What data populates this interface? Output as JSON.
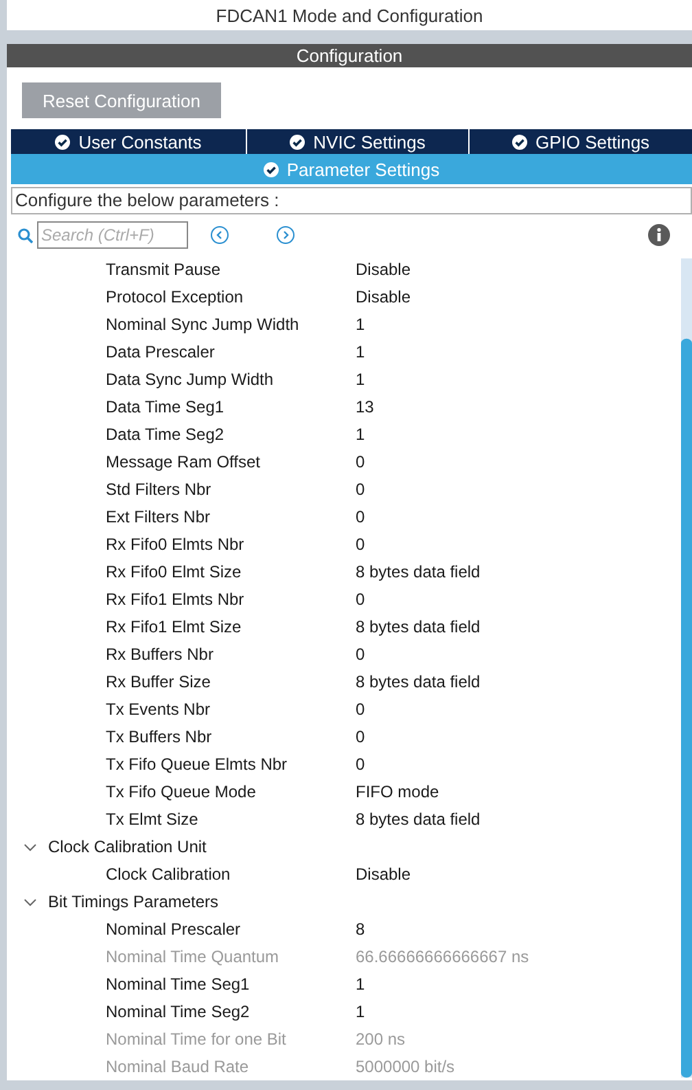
{
  "window": {
    "title": "FDCAN1 Mode and Configuration"
  },
  "section_header": "Configuration",
  "reset_button": "Reset Configuration",
  "tabs": [
    {
      "label": "User Constants",
      "selected": false,
      "kind": "upper"
    },
    {
      "label": "NVIC Settings",
      "selected": false,
      "kind": "upper"
    },
    {
      "label": "GPIO Settings",
      "selected": false,
      "kind": "upper"
    },
    {
      "label": "Parameter Settings",
      "selected": true,
      "kind": "lower"
    }
  ],
  "description": "Configure the below parameters :",
  "search": {
    "placeholder": "Search (Ctrl+F)"
  },
  "parameters": [
    {
      "name": "Transmit Pause",
      "value": "Disable",
      "disabled": false
    },
    {
      "name": "Protocol Exception",
      "value": "Disable",
      "disabled": false
    },
    {
      "name": "Nominal Sync Jump Width",
      "value": "1",
      "disabled": false
    },
    {
      "name": "Data Prescaler",
      "value": "1",
      "disabled": false
    },
    {
      "name": "Data Sync Jump Width",
      "value": "1",
      "disabled": false
    },
    {
      "name": "Data Time Seg1",
      "value": "13",
      "disabled": false
    },
    {
      "name": "Data Time Seg2",
      "value": "1",
      "disabled": false
    },
    {
      "name": "Message Ram Offset",
      "value": "0",
      "disabled": false
    },
    {
      "name": "Std Filters Nbr",
      "value": "0",
      "disabled": false
    },
    {
      "name": "Ext Filters Nbr",
      "value": "0",
      "disabled": false
    },
    {
      "name": "Rx Fifo0 Elmts Nbr",
      "value": "0",
      "disabled": false
    },
    {
      "name": "Rx Fifo0 Elmt Size",
      "value": "8 bytes data field",
      "disabled": false
    },
    {
      "name": "Rx Fifo1 Elmts Nbr",
      "value": "0",
      "disabled": false
    },
    {
      "name": "Rx Fifo1 Elmt Size",
      "value": "8 bytes data field",
      "disabled": false
    },
    {
      "name": "Rx Buffers Nbr",
      "value": "0",
      "disabled": false
    },
    {
      "name": "Rx Buffer Size",
      "value": "8 bytes data field",
      "disabled": false
    },
    {
      "name": "Tx Events Nbr",
      "value": "0",
      "disabled": false
    },
    {
      "name": "Tx Buffers Nbr",
      "value": "0",
      "disabled": false
    },
    {
      "name": "Tx Fifo Queue Elmts Nbr",
      "value": "0",
      "disabled": false
    },
    {
      "name": "Tx Fifo Queue Mode",
      "value": "FIFO mode",
      "disabled": false
    },
    {
      "name": "Tx Elmt Size",
      "value": "8 bytes data field",
      "disabled": false
    }
  ],
  "groups": [
    {
      "name": "Clock Calibration Unit",
      "expanded": true,
      "children": [
        {
          "name": "Clock Calibration",
          "value": "Disable",
          "disabled": false
        }
      ]
    },
    {
      "name": "Bit Timings Parameters",
      "expanded": true,
      "children": [
        {
          "name": "Nominal Prescaler",
          "value": "8",
          "disabled": false
        },
        {
          "name": "Nominal Time Quantum",
          "value": "66.66666666666667 ns",
          "disabled": true
        },
        {
          "name": "Nominal Time Seg1",
          "value": "1",
          "disabled": false
        },
        {
          "name": "Nominal Time Seg2",
          "value": "1",
          "disabled": false
        },
        {
          "name": "Nominal Time for one Bit",
          "value": "200 ns",
          "disabled": true
        },
        {
          "name": "Nominal Baud Rate",
          "value": "5000000 bit/s",
          "disabled": true
        }
      ]
    }
  ]
}
